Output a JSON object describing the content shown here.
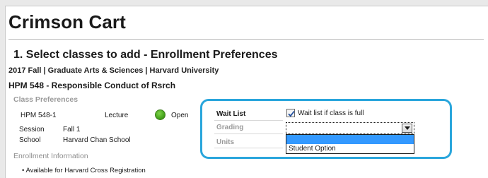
{
  "app": {
    "title": "Crimson Cart"
  },
  "step": {
    "heading": "1. Select classes to add - Enrollment Preferences"
  },
  "term_line": "2017 Fall | Graduate Arts & Sciences | Harvard University",
  "course": {
    "title": "HPM  548 - Responsible Conduct of Rsrch"
  },
  "class_preferences": {
    "label": "Class Preferences",
    "section": "HPM  548-1",
    "component": "Lecture",
    "status": "Open",
    "status_color": "#46a51d",
    "session_label": "Session",
    "session_value": "Fall 1",
    "school_label": "School",
    "school_value": "Harvard Chan School"
  },
  "enrollment_info": {
    "label": "Enrollment Information",
    "bullet": "Available for Harvard Cross Registration"
  },
  "options": {
    "wait_list_label": "Wait List",
    "wait_list_checked": true,
    "wait_list_checkbox_label": "Wait list if class is full",
    "grading_label": "Grading",
    "grading_value": "",
    "grading_options": [
      "",
      "Student Option"
    ],
    "units_label": "Units"
  },
  "highlight_color": "#2aa6dc",
  "selected_option_color": "#3399ff"
}
